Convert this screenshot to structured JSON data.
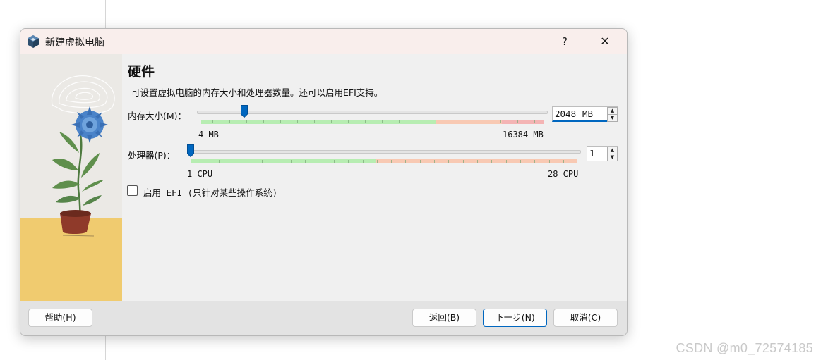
{
  "window": {
    "title": "新建虚拟电脑",
    "help_glyph": "?",
    "close_glyph": "✕"
  },
  "page": {
    "title": "硬件",
    "description": "可设置虚拟电脑的内存大小和处理器数量。还可以启用EFI支持。"
  },
  "memory": {
    "label": "内存大小(M)：",
    "value": "2048",
    "unit": "MB",
    "min_label": "4 MB",
    "max_label": "16384 MB",
    "min": 4,
    "max": 16384,
    "current": 2048
  },
  "cpu": {
    "label": "处理器(P)：",
    "value": "1",
    "min_label": "1 CPU",
    "max_label": "28 CPU",
    "min": 1,
    "max": 28,
    "current": 1
  },
  "efi": {
    "label": "启用 EFI (只针对某些操作系统)",
    "checked": false
  },
  "buttons": {
    "help": "帮助(H)",
    "back": "返回(B)",
    "next": "下一步(N)",
    "cancel": "取消(C)"
  },
  "watermark": "CSDN @m0_72574185",
  "colors": {
    "accent": "#0067c0",
    "recommended_range": "#b7edb2",
    "warning_range": "#f8c9b3",
    "danger_range": "#f4b4b4"
  }
}
